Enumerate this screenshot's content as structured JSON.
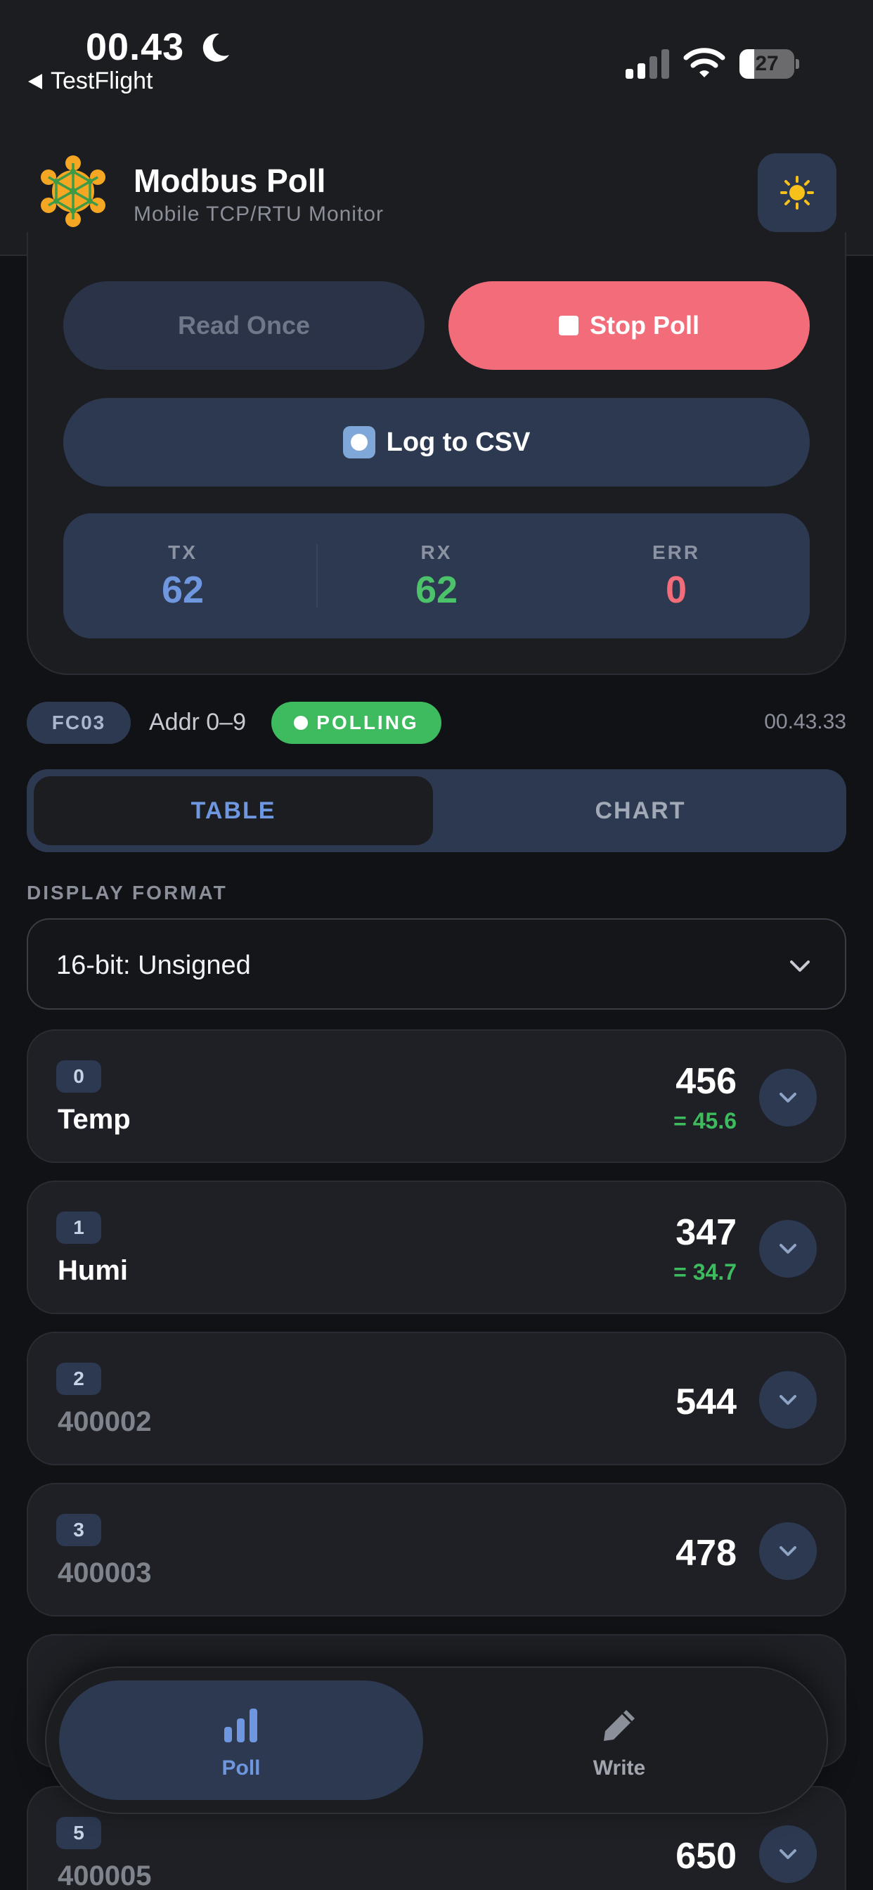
{
  "status_bar": {
    "time": "00.43",
    "back_app": "TestFlight",
    "battery": "27"
  },
  "header": {
    "title": "Modbus Poll",
    "subtitle": "Mobile TCP/RTU Monitor"
  },
  "controls": {
    "read_once_label": "Read Once",
    "stop_poll_label": "Stop Poll",
    "log_csv_label": "Log to CSV"
  },
  "stats": {
    "tx_label": "TX",
    "tx_value": "62",
    "rx_label": "RX",
    "rx_value": "62",
    "err_label": "ERR",
    "err_value": "0"
  },
  "info": {
    "function_code": "FC03",
    "address_range": "Addr 0–9",
    "status": "POLLING",
    "timestamp": "00.43.33"
  },
  "tabs": {
    "table_label": "TABLE",
    "chart_label": "CHART"
  },
  "display_format": {
    "label": "DISPLAY FORMAT",
    "value": "16-bit: Unsigned"
  },
  "registers": [
    {
      "index": "0",
      "name": "Temp",
      "value": "456",
      "scaled": "= 45.6"
    },
    {
      "index": "1",
      "name": "Humi",
      "value": "347",
      "scaled": "= 34.7"
    },
    {
      "index": "2",
      "name": "400002",
      "value": "544"
    },
    {
      "index": "3",
      "name": "400003",
      "value": "478"
    },
    {
      "index": "5",
      "name": "400005",
      "value": "650"
    }
  ],
  "bottom_nav": {
    "poll_label": "Poll",
    "write_label": "Write"
  },
  "colors": {
    "accent_blue": "#6f97e0",
    "stop_red": "#f26d79",
    "polling_green": "#3dbb5e",
    "tx_blue": "#6f97e0",
    "rx_green": "#4cc26b",
    "err_red": "#f26d79"
  },
  "icons": {
    "status_moon": "moon-icon",
    "theme": "sun-icon",
    "log": "record-icon",
    "expand": "chevron-down-icon",
    "nav_poll": "bar-chart-icon",
    "nav_write": "pencil-icon"
  }
}
